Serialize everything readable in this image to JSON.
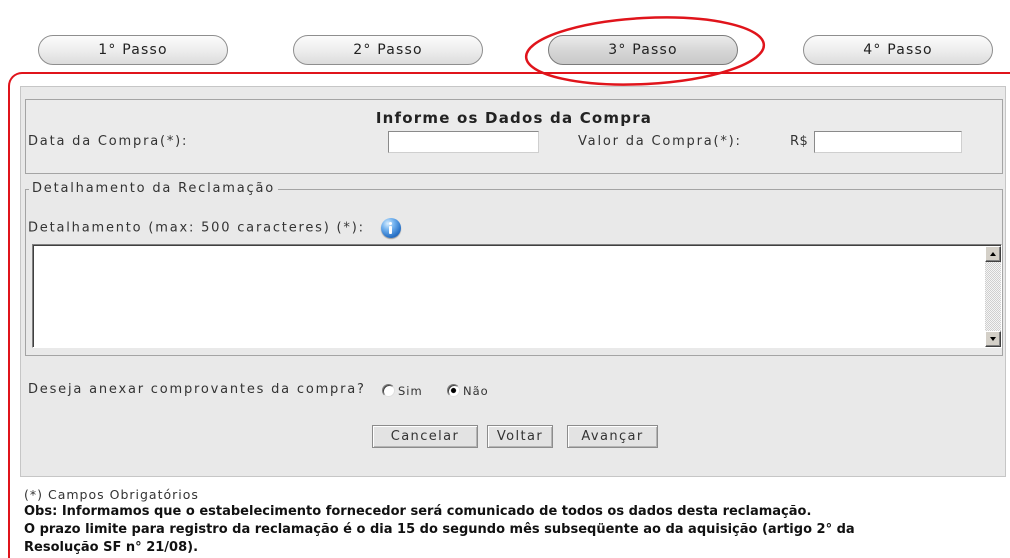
{
  "steps": [
    {
      "label": "1° Passo",
      "active": false
    },
    {
      "label": "2° Passo",
      "active": false
    },
    {
      "label": "3° Passo",
      "active": true
    },
    {
      "label": "4° Passo",
      "active": false
    }
  ],
  "colors": {
    "accent": "#e0141b",
    "form_background": "#e9e9e9"
  },
  "purchase": {
    "title": "Informe os Dados da Compra",
    "date_label": "Data da Compra(*):",
    "date_value": "",
    "value_label": "Valor da Compra(*):",
    "currency": "R$",
    "value_value": ""
  },
  "details": {
    "legend": "Detalhamento da Reclamação",
    "label": "Detalhamento (max: 500 caracteres) (*):",
    "icon": "info-icon",
    "text": ""
  },
  "attachments": {
    "question": "Deseja anexar comprovantes da compra?",
    "options": [
      {
        "label": "Sim",
        "checked": false
      },
      {
        "label": "Não",
        "checked": true
      }
    ]
  },
  "buttons": {
    "cancel": "Cancelar",
    "back": "Voltar",
    "next": "Avançar"
  },
  "notes": {
    "required": "(*) Campos Obrigatórios",
    "obs": "Obs: Informamos que o estabelecimento fornecedor será comunicado de todos os dados desta reclamação.",
    "deadline_lines": [
      "O prazo limite para registro da reclamação é o dia 15 do segundo mês subseqüente ao da aquisição (artigo 2° da",
      "Resolução SF n° 21/08)."
    ]
  }
}
